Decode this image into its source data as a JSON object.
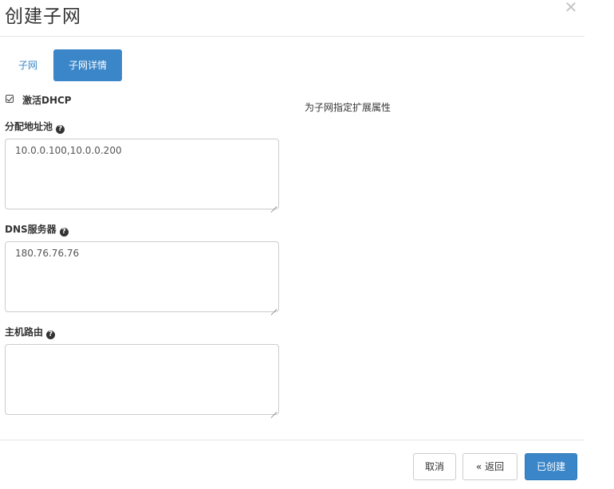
{
  "modal": {
    "title": "创建子网",
    "close_icon": "close-icon",
    "close_glyph": "✕"
  },
  "tabs": [
    {
      "label": "子网",
      "active": false
    },
    {
      "label": "子网详情",
      "active": true
    }
  ],
  "form": {
    "enable_dhcp": {
      "label": "激活DHCP",
      "checked": true
    },
    "allocation_pools": {
      "label": "分配地址池",
      "value": "10.0.0.100,10.0.0.200"
    },
    "dns_servers": {
      "label": "DNS服务器",
      "value": "180.76.76.76"
    },
    "host_routes": {
      "label": "主机路由",
      "value": ""
    },
    "help_icon_glyph": "?"
  },
  "help": {
    "text": "为子网指定扩展属性"
  },
  "footer": {
    "cancel_label": "取消",
    "back_label": "« 返回",
    "create_label": "已创建"
  },
  "colors": {
    "primary": "#3b86c8",
    "border": "#cccccc",
    "text": "#333333"
  }
}
